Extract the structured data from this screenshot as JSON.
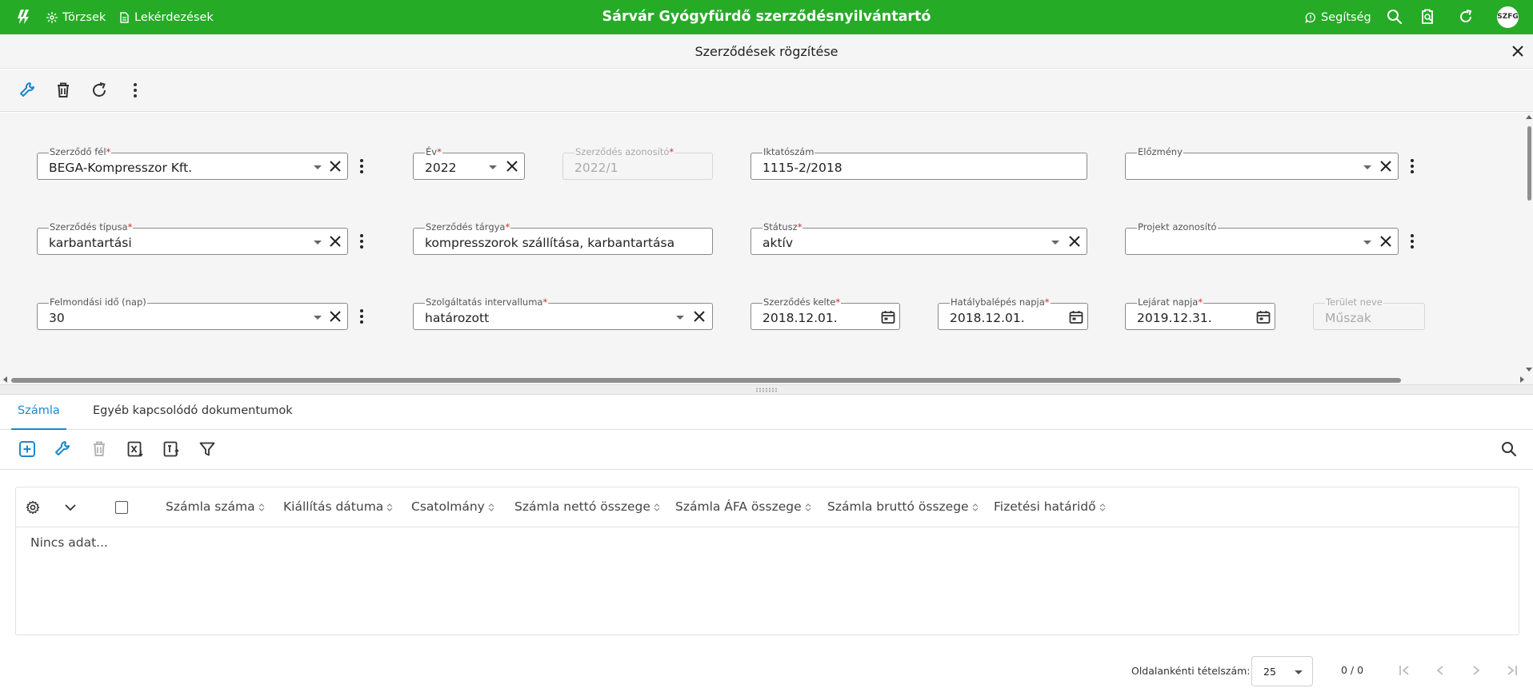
{
  "topbar": {
    "title": "Sárvár Gyógyfürdő szerződésnyilvántartó",
    "nav": [
      {
        "label": "Törzsek",
        "icon": "sparkle-icon"
      },
      {
        "label": "Lekérdezések",
        "icon": "document-icon"
      }
    ],
    "help_label": "Segítség",
    "avatar_initials": "SZFG",
    "accent_color": "#26ab27"
  },
  "page": {
    "title": "Szerződések rögzítése"
  },
  "form": {
    "party": {
      "label": "Szerződő fél",
      "value": "BEGA-Kompresszor Kft."
    },
    "year": {
      "label": "Év",
      "value": "2022"
    },
    "contract_id": {
      "label": "Szerződés azonosító",
      "value": "2022/1"
    },
    "filing_no": {
      "label": "Iktatószám",
      "value": "1115-2/2018"
    },
    "previous": {
      "label": "Előzmény",
      "value": ""
    },
    "contract_type": {
      "label": "Szerződés típusa",
      "value": "karbantartási"
    },
    "subject": {
      "label": "Szerződés tárgya",
      "value": "kompresszorok szállítása, karbantartása"
    },
    "status": {
      "label": "Státusz",
      "value": "aktív"
    },
    "project_id": {
      "label": "Projekt azonosító",
      "value": ""
    },
    "notice": {
      "label": "Felmondási idő (nap)",
      "value": "30"
    },
    "interval": {
      "label": "Szolgáltatás intervalluma",
      "value": "határozott"
    },
    "signed": {
      "label": "Szerződés kelte",
      "value": "2018.12.01."
    },
    "effective": {
      "label": "Hatálybalépés napja",
      "value": "2018.12.01."
    },
    "expiry": {
      "label": "Lejárat napja",
      "value": "2019.12.31."
    },
    "area": {
      "label": "Terület neve",
      "value": "Műszak"
    }
  },
  "tabs": [
    {
      "label": "Számla",
      "active": true
    },
    {
      "label": "Egyéb kapcsolódó dokumentumok",
      "active": false
    }
  ],
  "grid": {
    "columns": [
      "Számla száma",
      "Kiállítás dátuma",
      "Csatolmány",
      "Számla nettó összege",
      "Számla ÁFA összege",
      "Számla bruttó összege",
      "Fizetési határidő"
    ],
    "empty_text": "Nincs adat..."
  },
  "pager": {
    "page_size_label": "Oldalankénti tételszám:",
    "page_size": "25",
    "count": "0 / 0"
  }
}
